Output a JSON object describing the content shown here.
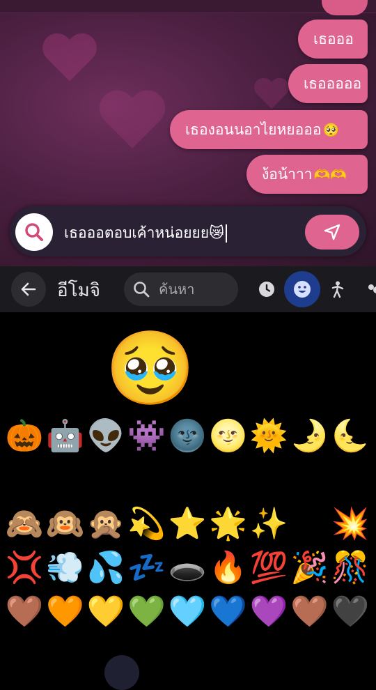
{
  "chat": {
    "messages": [
      {
        "text": "เธอออ"
      },
      {
        "text": "เธอออออ"
      },
      {
        "text": "เธองอนนอาไยหยอออ",
        "emoji": "🥺"
      },
      {
        "text": "ง้อน้าาา",
        "emoji": "🫶🫶"
      }
    ],
    "input": {
      "value": "เธอออตอบเค้าหน่อยยย",
      "emoji": "😿"
    }
  },
  "keyboard": {
    "title": "อีโมจิ",
    "search_placeholder": "ค้นหา",
    "categories": [
      {
        "icon": "clock-icon"
      },
      {
        "icon": "smiley-icon",
        "active": true
      },
      {
        "icon": "person-icon"
      },
      {
        "icon": "animal-icon"
      }
    ],
    "featured": [
      "😹",
      "🥹",
      "😸",
      "😽"
    ],
    "grid": [
      [
        "🎃",
        "🤖",
        "👽",
        "👾",
        "🌚",
        "🌝",
        "🌞",
        "🌛",
        "🌜"
      ],
      [
        "😸",
        "😺",
        "😹",
        "😻",
        "😼",
        "😽",
        "🙀",
        "😿",
        "😾"
      ],
      [
        "🙈",
        "🙉",
        "🙊",
        "💫",
        "⭐",
        "🌟",
        "✨",
        "⚡",
        "💥"
      ],
      [
        "💢",
        "💨",
        "💦",
        "💤",
        "🕳️",
        "🔥",
        "💯",
        "🎉",
        "🎊"
      ],
      [
        "🤎",
        "🧡",
        "💛",
        "💚",
        "🩵",
        "💙",
        "💜",
        "🤎",
        "🖤"
      ]
    ]
  },
  "colors": {
    "bubble": "#e06490",
    "accent_blue": "#1f3d8f"
  }
}
